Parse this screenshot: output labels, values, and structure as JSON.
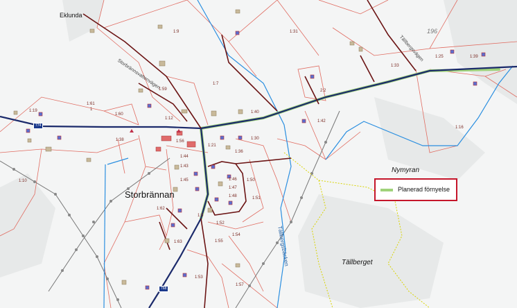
{
  "place_names": {
    "eklunda": "Eklunda",
    "storbrannan": "Storbrännan",
    "tallberget": "Tällberget",
    "nymyran": "Nymyran"
  },
  "elevation": "196",
  "road_names": {
    "north": "Storbrännsvattenvägen",
    "east": "Tällbergsvägen"
  },
  "stream_name": "Tällbergsbäcken",
  "road_shields": {
    "west": "774",
    "south": "768"
  },
  "parcels": {
    "p1_9": "1:9",
    "p1_31": "1:31",
    "p1_33": "1:33",
    "p1_7": "1:7",
    "p1_61": "1:61",
    "p1": "1",
    "p1_19": "1:19",
    "p1_59": "1:59",
    "p1_60": "1:60",
    "p1_12": "1:12",
    "p1_40": "1:40",
    "p2_2": "2:2",
    "p1_42": "1:42",
    "p1_16": "1:16",
    "p1_25": "1:25",
    "p1_39": "1:39",
    "p1_38": "1:38",
    "p1_56": "1:56",
    "p1_21": "1:21",
    "p1_30": "1:30",
    "p1_36": "1:36",
    "p1_44": "1:44",
    "p1_43": "1:43",
    "p1_45": "1:45",
    "p1_46": "1:46",
    "p1_47": "1:47",
    "p1_48": "1:48",
    "p1_50": "1:50",
    "p1_51": "1:51",
    "p1_52": "1:52",
    "p1_54": "1:54",
    "p1_55": "1:55",
    "p1_53": "1:53",
    "p1_57": "1:57",
    "p1_10": "1:10",
    "p1_62": "1:62",
    "p1_63": "1:63",
    "p1_3": "1:3"
  },
  "legend": {
    "label": "Planerad förnyelse",
    "swatch_color": "#9fd27a",
    "border_color": "#c5152a"
  },
  "colors": {
    "main_road": "#1b2a6b",
    "local_road": "#6b1414",
    "power_line": "#777777",
    "water": "#2b8fe0",
    "property_line": "#e06b60",
    "trail": "#d8d400"
  }
}
